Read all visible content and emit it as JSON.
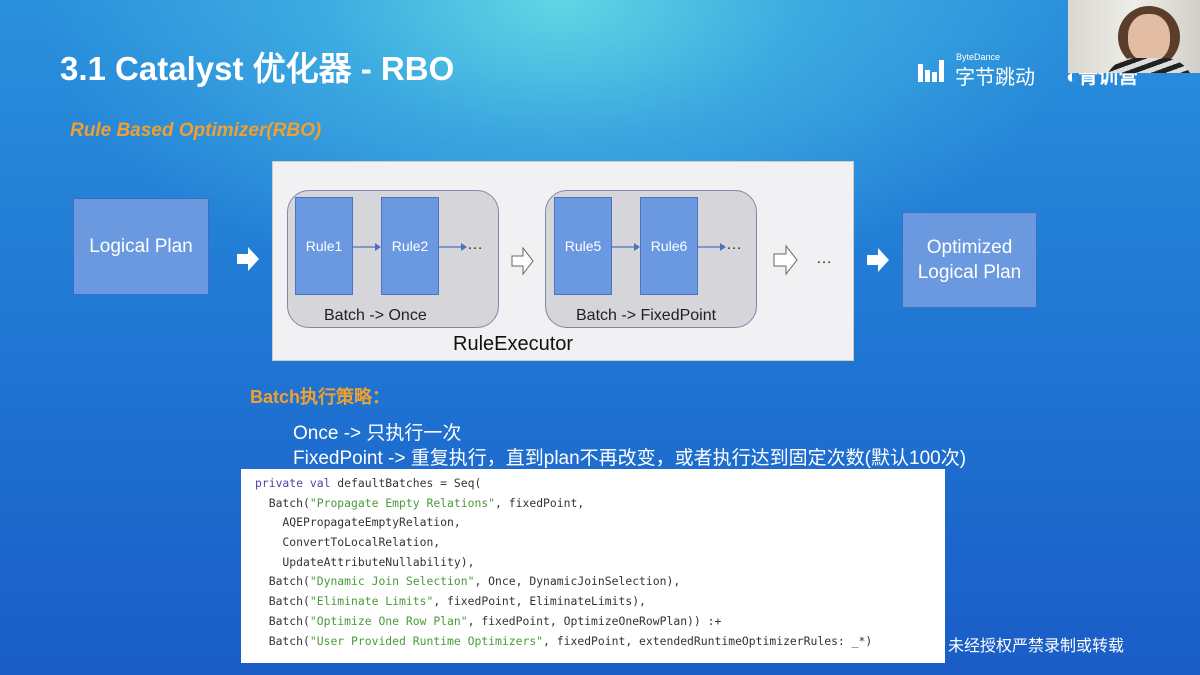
{
  "slide": {
    "title": "3.1 Catalyst 优化器 - RBO",
    "subtitle": "Rule Based Optimizer(RBO)",
    "diagram": {
      "input": "Logical Plan",
      "output_line1": "Optimized",
      "output_line2": "Logical Plan",
      "executor_label": "RuleExecutor",
      "batches": [
        {
          "rules": [
            "Rule1",
            "Rule2"
          ],
          "label": "Batch -> Once"
        },
        {
          "rules": [
            "Rule5",
            "Rule6"
          ],
          "label": "Batch -> FixedPoint"
        }
      ],
      "ellipsis": "…"
    },
    "strategy_title": "Batch执行策略：",
    "strategy_lines": [
      "Once -> 只执行一次",
      "FixedPoint -> 重复执行，直到plan不再改变，或者执行达到固定次数(默认100次)"
    ],
    "code_lines": [
      [
        {
          "t": "private val",
          "k": "kw"
        },
        {
          "t": " defaultBatches = Seq(",
          "k": "plain"
        }
      ],
      [
        {
          "t": "  Batch(",
          "k": "plain"
        },
        {
          "t": "\"Propagate Empty Relations\"",
          "k": "str"
        },
        {
          "t": ", fixedPoint,",
          "k": "plain"
        }
      ],
      [
        {
          "t": "    AQEPropagateEmptyRelation,",
          "k": "plain"
        }
      ],
      [
        {
          "t": "    ConvertToLocalRelation,",
          "k": "plain"
        }
      ],
      [
        {
          "t": "    UpdateAttributeNullability),",
          "k": "plain"
        }
      ],
      [
        {
          "t": "  Batch(",
          "k": "plain"
        },
        {
          "t": "\"Dynamic Join Selection\"",
          "k": "str"
        },
        {
          "t": ", Once, DynamicJoinSelection),",
          "k": "plain"
        }
      ],
      [
        {
          "t": "  Batch(",
          "k": "plain"
        },
        {
          "t": "\"Eliminate Limits\"",
          "k": "str"
        },
        {
          "t": ", fixedPoint, EliminateLimits),",
          "k": "plain"
        }
      ],
      [
        {
          "t": "  Batch(",
          "k": "plain"
        },
        {
          "t": "\"Optimize One Row Plan\"",
          "k": "str"
        },
        {
          "t": ", fixedPoint, OptimizeOneRowPlan)) :+",
          "k": "plain"
        }
      ],
      [
        {
          "t": "  Batch(",
          "k": "plain"
        },
        {
          "t": "\"User Provided Runtime Optimizers\"",
          "k": "str"
        },
        {
          "t": ", fixedPoint, extendedRuntimeOptimizerRules: _*)",
          "k": "plain"
        }
      ]
    ]
  },
  "branding": {
    "bytedance_en": "ByteDance",
    "bytedance_cn": "字节跳动",
    "camp": "青训营"
  },
  "watermark": "未经授权严禁录制或转载",
  "colors": {
    "accent_orange": "#f0a030",
    "rule_blue": "#6a99e2"
  }
}
